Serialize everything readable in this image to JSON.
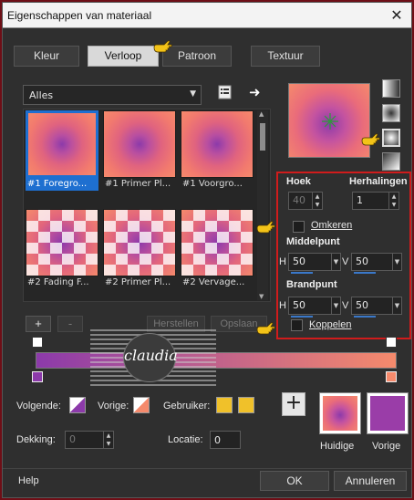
{
  "window": {
    "title": "Eigenschappen van materiaal",
    "close_glyph": "✕"
  },
  "tabs": [
    {
      "label": "Kleur",
      "active": false
    },
    {
      "label": "Verloop",
      "active": true
    },
    {
      "label": "Patroon",
      "active": false
    },
    {
      "label": "Textuur",
      "active": false
    }
  ],
  "library": {
    "selected": "Alles",
    "items": [
      {
        "label": "#1 Foregro...",
        "style": "radial",
        "selected": true
      },
      {
        "label": "#1 Primer Pl...",
        "style": "radial",
        "selected": false
      },
      {
        "label": "#1 Voorgro...",
        "style": "radial",
        "selected": false
      },
      {
        "label": "#2 Fading F...",
        "style": "checker",
        "selected": false
      },
      {
        "label": "#2 Primer Pl...",
        "style": "checker",
        "selected": false
      },
      {
        "label": "#2 Vervage...",
        "style": "checker",
        "selected": false
      }
    ],
    "add_label": "+",
    "remove_label": "-",
    "restore_label": "Herstellen",
    "save_label": "Opslaan"
  },
  "settings": {
    "angle_label": "Hoek",
    "angle_value": "40",
    "repeats_label": "Herhalingen",
    "repeats_value": "1",
    "invert_label": "Omkeren",
    "invert_checked": false,
    "midpoint_label": "Middelpunt",
    "mid_h_label": "H",
    "mid_h_value": "50",
    "mid_v_label": "V",
    "mid_v_value": "50",
    "focal_label": "Brandpunt",
    "focal_h_label": "H",
    "focal_h_value": "50",
    "focal_v_label": "V",
    "focal_v_value": "50",
    "link_label": "Koppelen",
    "link_checked": false
  },
  "editor": {
    "followed_label": "Volgende:",
    "previous_label": "Vorige:",
    "user_label": "Gebruiker:",
    "opacity_label": "Dekking:",
    "opacity_value": "0",
    "location_label": "Locatie:",
    "location_value": "0",
    "watermark_text": "claudia"
  },
  "preview": {
    "current_label": "Huidige",
    "previous_label": "Vorige",
    "plus_label": "+"
  },
  "footer": {
    "help_label": "Help",
    "ok_label": "OK",
    "cancel_label": "Annuleren"
  },
  "colors": {
    "gradient_start": "#8c3aaa",
    "gradient_end": "#f58a6c",
    "swatch_user": "#f0c12a",
    "highlight_box": "#d01c1c",
    "selection": "#1e6fd0"
  }
}
